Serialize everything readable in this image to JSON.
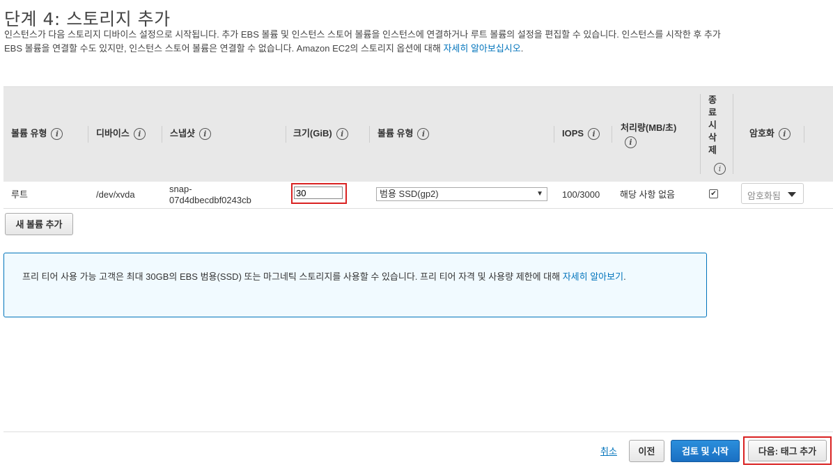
{
  "page": {
    "title": "단계 4: 스토리지 추가",
    "intro_text": "인스턴스가 다음 스토리지 디바이스 설정으로 시작됩니다. 추가 EBS 볼륨 및 인스턴스 스토어 볼륨을 인스턴스에 연결하거나 루트 볼륨의 설정을 편집할 수 있습니다. 인스턴스를 시작한 후 추가 EBS 볼륨을 연결할 수도 있지만, 인스턴스 스토어 볼륨은 연결할 수 없습니다. Amazon EC2의 스토리지 옵션에 대해 ",
    "intro_link": "자세히 알아보십시오",
    "intro_end": "."
  },
  "table": {
    "headers": {
      "volume_type": "볼륨 유형",
      "device": "디바이스",
      "snapshot": "스냅샷",
      "size": "크기(GiB)",
      "volume_kind": "볼륨 유형",
      "iops": "IOPS",
      "throughput": "처리량(MB/초)",
      "delete_on_termination": "종료 시 삭제",
      "encryption": "암호화"
    },
    "delete_on_termination_chars": [
      "종",
      "료",
      "시",
      "삭",
      "제"
    ],
    "info_icon": "i",
    "rows": [
      {
        "volume_type": "루트",
        "device": "/dev/xvda",
        "snapshot_line1": "snap-",
        "snapshot_line2": "07d4dbecdbf0243cb",
        "size": "30",
        "volume_kind": "범용 SSD(gp2)",
        "iops": "100/3000",
        "throughput": "해당 사항 없음",
        "delete_on_termination": "✔",
        "encryption": "암호화됨"
      }
    ]
  },
  "add_volume_button": "새 볼륨 추가",
  "notice": {
    "text": "프리 티어 사용 가능 고객은 최대 30GB의 EBS 범용(SSD) 또는 마그네틱 스토리지를 사용할 수 있습니다. 프리 티어 자격 및 사용량 제한에 대해 ",
    "link": "자세히 알아보기",
    "end": "."
  },
  "footer": {
    "cancel": "취소",
    "previous": "이전",
    "review_launch": "검토 및 시작",
    "next": "다음: 태그 추가"
  },
  "colors": {
    "link": "#0073bb",
    "primary": "#1a6fc2",
    "highlight": "#d92121"
  }
}
